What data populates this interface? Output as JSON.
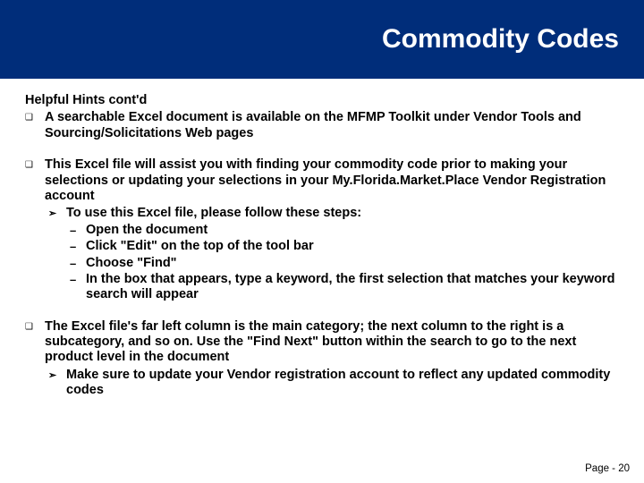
{
  "header": {
    "title": "Commodity Codes"
  },
  "content": {
    "heading": "Helpful Hints cont'd",
    "bullets": [
      {
        "text": "A searchable Excel document is available on the MFMP Toolkit under Vendor Tools and Sourcing/Solicitations Web pages"
      },
      {
        "text": "This Excel file will assist you with finding your commodity code prior to making your selections or updating your selections in your My.Florida.Market.Place Vendor Registration account",
        "sub": [
          {
            "text": "To use this Excel file, please follow these steps:",
            "steps": [
              "Open the document",
              "Click \"Edit\" on the top of the tool bar",
              "Choose \"Find\"",
              "In the box that appears, type a keyword, the first selection that matches your keyword search will appear"
            ]
          }
        ]
      },
      {
        "text": "The Excel file's far left column is the main category; the next column to the right is a subcategory, and so on. Use the \"Find Next\" button within the search to go to the next product level in the document",
        "sub": [
          {
            "text": "Make sure to update your Vendor registration account to reflect any updated commodity codes"
          }
        ]
      }
    ]
  },
  "footer": {
    "page_label": "Page - 20"
  },
  "symbols": {
    "square": "❑",
    "arrow": "➢",
    "dash": "–"
  }
}
